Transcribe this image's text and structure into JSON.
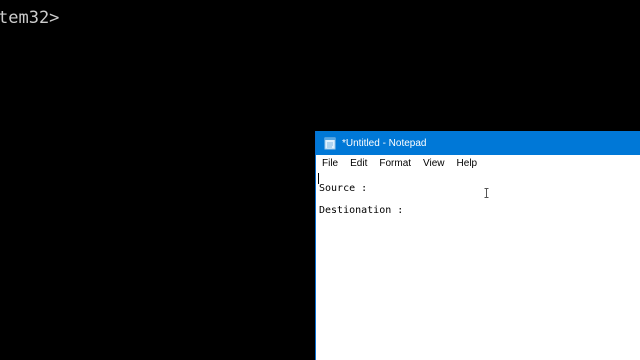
{
  "console": {
    "prompt_text": "tem32>"
  },
  "notepad": {
    "title": "*Untitled - Notepad",
    "app_icon": "notepad-icon",
    "menu": [
      "File",
      "Edit",
      "Format",
      "View",
      "Help"
    ],
    "content_lines": [
      "Source :",
      "Destionation :"
    ]
  },
  "colors": {
    "console_bg": "#000000",
    "console_fg": "#cccccc",
    "titlebar_bg": "#0078d7",
    "titlebar_fg": "#ffffff"
  },
  "cursor_icon": "text-cursor-icon"
}
